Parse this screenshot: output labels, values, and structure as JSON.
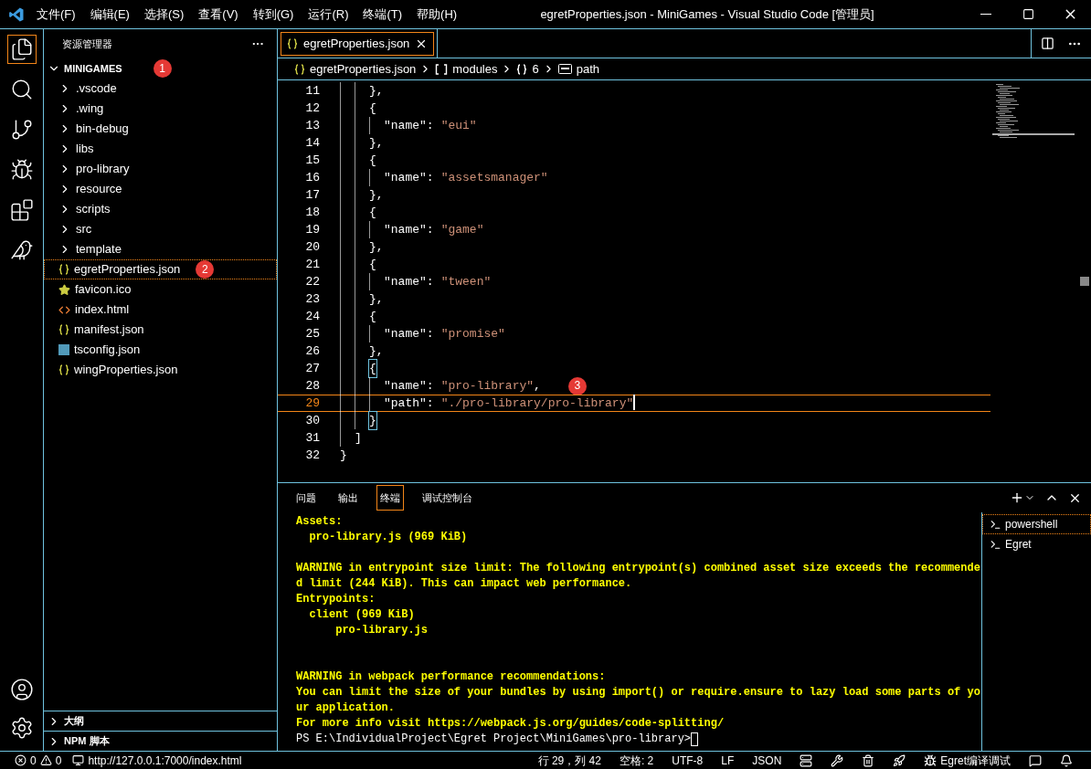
{
  "titlebar": {
    "menus": [
      "文件(F)",
      "编辑(E)",
      "选择(S)",
      "查看(V)",
      "转到(G)",
      "运行(R)",
      "终端(T)",
      "帮助(H)"
    ],
    "title": "egretProperties.json - MiniGames - Visual Studio Code [管理员]"
  },
  "activity_bar": {
    "top": [
      {
        "kind": "files",
        "selected": true
      },
      {
        "kind": "search",
        "selected": false
      },
      {
        "kind": "scm",
        "selected": false
      },
      {
        "kind": "debug",
        "selected": false
      },
      {
        "kind": "extensions",
        "selected": false
      },
      {
        "kind": "bird",
        "selected": false
      }
    ],
    "bottom": [
      {
        "kind": "account"
      },
      {
        "kind": "settings"
      }
    ]
  },
  "sidebar": {
    "title": "资源管理器",
    "more": "···",
    "root": {
      "label": "MINIGAMES",
      "expanded": true,
      "badge": "1",
      "children": [
        {
          "label": ".vscode",
          "kind": "folder",
          "expanded": false,
          "selected": false
        },
        {
          "label": ".wing",
          "kind": "folder",
          "expanded": false,
          "selected": false
        },
        {
          "label": "bin-debug",
          "kind": "folder",
          "expanded": false,
          "selected": false
        },
        {
          "label": "libs",
          "kind": "folder",
          "expanded": false,
          "selected": false
        },
        {
          "label": "pro-library",
          "kind": "folder",
          "expanded": false,
          "selected": false
        },
        {
          "label": "resource",
          "kind": "folder",
          "expanded": false,
          "selected": false
        },
        {
          "label": "scripts",
          "kind": "folder",
          "expanded": false,
          "selected": false
        },
        {
          "label": "src",
          "kind": "folder",
          "expanded": false,
          "selected": false
        },
        {
          "label": "template",
          "kind": "folder",
          "expanded": false,
          "selected": false
        },
        {
          "label": "egretProperties.json",
          "kind": "json",
          "selected": true,
          "badge": "2"
        },
        {
          "label": "favicon.ico",
          "kind": "star",
          "selected": false
        },
        {
          "label": "index.html",
          "kind": "html",
          "selected": false
        },
        {
          "label": "manifest.json",
          "kind": "json",
          "selected": false
        },
        {
          "label": "tsconfig.json",
          "kind": "ts",
          "selected": false
        },
        {
          "label": "wingProperties.json",
          "kind": "json",
          "selected": false
        }
      ]
    },
    "sections": [
      {
        "label": "大纲",
        "expanded": false
      },
      {
        "label": "NPM 脚本",
        "expanded": false
      }
    ]
  },
  "editor": {
    "tabs": [
      {
        "label": "egretProperties.json",
        "selected": true
      }
    ],
    "breadcrumb": [
      {
        "kind": "json",
        "label": "egretProperties.json"
      },
      {
        "kind": "array",
        "label": "modules"
      },
      {
        "kind": "object",
        "label": "6"
      },
      {
        "kind": "string",
        "label": "path"
      }
    ],
    "lines": [
      {
        "number": "11",
        "kind": "item_brace",
        "tokens": [
          {
            "kind": "punct",
            "text": "},"
          }
        ]
      },
      {
        "number": "12",
        "kind": "item_brace",
        "tokens": [
          {
            "kind": "punct",
            "text": "{"
          }
        ]
      },
      {
        "number": "13",
        "kind": "item_field",
        "tokens": [
          {
            "kind": "key",
            "text": "\"name\""
          },
          {
            "kind": "punct",
            "text": ":"
          },
          {
            "kind": "str",
            "text": "\"eui\""
          }
        ]
      },
      {
        "number": "14",
        "kind": "item_brace",
        "tokens": [
          {
            "kind": "punct",
            "text": "},"
          }
        ]
      },
      {
        "number": "15",
        "kind": "item_brace",
        "tokens": [
          {
            "kind": "punct",
            "text": "{"
          }
        ]
      },
      {
        "number": "16",
        "kind": "item_field",
        "tokens": [
          {
            "kind": "key",
            "text": "\"name\""
          },
          {
            "kind": "punct",
            "text": ":"
          },
          {
            "kind": "str",
            "text": "\"assetsmanager\""
          }
        ]
      },
      {
        "number": "17",
        "kind": "item_brace",
        "tokens": [
          {
            "kind": "punct",
            "text": "},"
          }
        ]
      },
      {
        "number": "18",
        "kind": "item_brace",
        "tokens": [
          {
            "kind": "punct",
            "text": "{"
          }
        ]
      },
      {
        "number": "19",
        "kind": "item_field",
        "tokens": [
          {
            "kind": "key",
            "text": "\"name\""
          },
          {
            "kind": "punct",
            "text": ":"
          },
          {
            "kind": "str",
            "text": "\"game\""
          }
        ]
      },
      {
        "number": "20",
        "kind": "item_brace",
        "tokens": [
          {
            "kind": "punct",
            "text": "},"
          }
        ]
      },
      {
        "number": "21",
        "kind": "item_brace",
        "tokens": [
          {
            "kind": "punct",
            "text": "{"
          }
        ]
      },
      {
        "number": "22",
        "kind": "item_field",
        "tokens": [
          {
            "kind": "key",
            "text": "\"name\""
          },
          {
            "kind": "punct",
            "text": ":"
          },
          {
            "kind": "str",
            "text": "\"tween\""
          }
        ]
      },
      {
        "number": "23",
        "kind": "item_brace",
        "tokens": [
          {
            "kind": "punct",
            "text": "},"
          }
        ]
      },
      {
        "number": "24",
        "kind": "item_brace",
        "tokens": [
          {
            "kind": "punct",
            "text": "{"
          }
        ]
      },
      {
        "number": "25",
        "kind": "item_field",
        "tokens": [
          {
            "kind": "key",
            "text": "\"name\""
          },
          {
            "kind": "punct",
            "text": ":"
          },
          {
            "kind": "str",
            "text": "\"promise\""
          }
        ]
      },
      {
        "number": "26",
        "kind": "item_brace",
        "tokens": [
          {
            "kind": "punct",
            "text": "},"
          }
        ]
      },
      {
        "number": "27",
        "kind": "item_brace",
        "bracket_match": true,
        "tokens": [
          {
            "kind": "punct",
            "text": "{"
          }
        ]
      },
      {
        "number": "28",
        "kind": "item_field",
        "badge": "3",
        "tokens": [
          {
            "kind": "key",
            "text": "\"name\""
          },
          {
            "kind": "punct",
            "text": ":"
          },
          {
            "kind": "str",
            "text": "\"pro-library\""
          },
          {
            "kind": "punct",
            "text": ","
          }
        ]
      },
      {
        "number": "29",
        "kind": "item_field",
        "current": true,
        "tokens": [
          {
            "kind": "key",
            "text": "\"path\""
          },
          {
            "kind": "punct",
            "text": ":"
          },
          {
            "kind": "str",
            "text": "\"./pro-library/pro-library\""
          }
        ]
      },
      {
        "number": "30",
        "kind": "item_brace",
        "bracket_match": true,
        "tokens": [
          {
            "kind": "punct",
            "text": "}"
          }
        ]
      },
      {
        "number": "31",
        "kind": "array_end",
        "tokens": [
          {
            "kind": "punct",
            "text": "]"
          }
        ]
      },
      {
        "number": "32",
        "kind": "root_end",
        "tokens": [
          {
            "kind": "punct",
            "text": "}"
          }
        ]
      }
    ]
  },
  "panel": {
    "tabs": [
      {
        "label": "问题",
        "selected": false
      },
      {
        "label": "输出",
        "selected": false
      },
      {
        "label": "终端",
        "selected": true
      },
      {
        "label": "调试控制台",
        "selected": false
      }
    ],
    "terminal_lines": [
      {
        "kind": "warn",
        "text": "Assets:"
      },
      {
        "kind": "warn",
        "text": "  pro-library.js (969 KiB)"
      },
      {
        "kind": "gap"
      },
      {
        "kind": "warn",
        "text": "WARNING in entrypoint size limit: The following entrypoint(s) combined asset size exceeds the recommende"
      },
      {
        "kind": "warn",
        "text": "d limit (244 KiB). This can impact web performance."
      },
      {
        "kind": "warn",
        "text": "Entrypoints:"
      },
      {
        "kind": "warn",
        "text": "  client (969 KiB)"
      },
      {
        "kind": "warn",
        "text": "      pro-library.js"
      },
      {
        "kind": "gap"
      },
      {
        "kind": "gap"
      },
      {
        "kind": "warn",
        "text": "WARNING in webpack performance recommendations:"
      },
      {
        "kind": "warn",
        "text": "You can limit the size of your bundles by using import() or require.ensure to lazy load some parts of yo"
      },
      {
        "kind": "warn",
        "text": "ur application."
      },
      {
        "kind": "warn",
        "text": "For more info visit https://webpack.js.org/guides/code-splitting/"
      },
      {
        "kind": "prompt",
        "text": "PS E:\\IndividualProject\\Egret Project\\MiniGames\\pro-library>"
      }
    ],
    "terminals": [
      {
        "label": "powershell",
        "selected": true
      },
      {
        "label": "Egret",
        "selected": false
      }
    ]
  },
  "status_bar": {
    "errors": "0",
    "warnings": "0",
    "url": "http://127.0.0.1:7000/index.html",
    "right": [
      {
        "kind": "text",
        "text": "行 29，列 42"
      },
      {
        "kind": "text",
        "text": "空格: 2"
      },
      {
        "kind": "text",
        "text": "UTF-8"
      },
      {
        "kind": "text",
        "text": "LF"
      },
      {
        "kind": "text",
        "text": "JSON"
      },
      {
        "kind": "server"
      },
      {
        "kind": "tools"
      },
      {
        "kind": "trash"
      },
      {
        "kind": "rocket"
      },
      {
        "kind": "bug",
        "text": "Egret编译调试"
      },
      {
        "kind": "feedback"
      },
      {
        "kind": "bell"
      }
    ]
  }
}
